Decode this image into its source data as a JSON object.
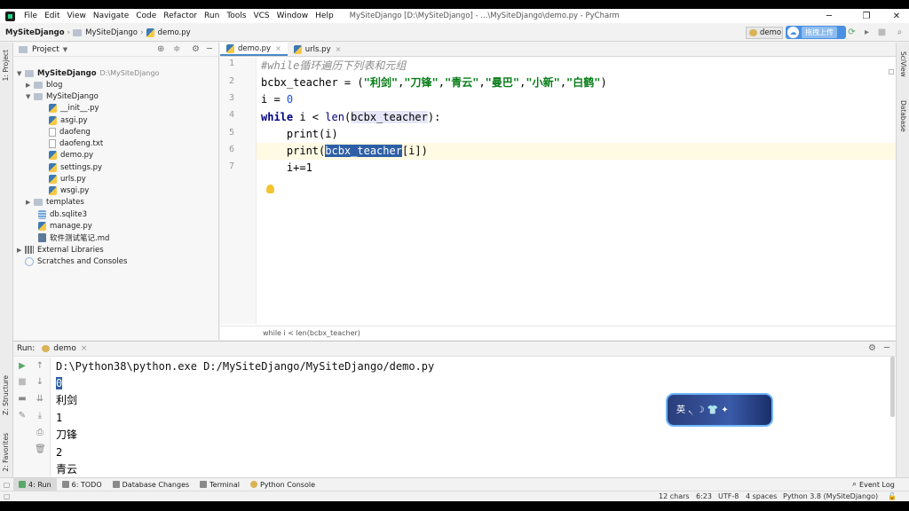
{
  "menubar": {
    "items": [
      "File",
      "Edit",
      "View",
      "Navigate",
      "Code",
      "Refactor",
      "Run",
      "Tools",
      "VCS",
      "Window",
      "Help"
    ],
    "window_title": "MySiteDjango [D:\\MySiteDjango] - ...\\MySiteDjango\\demo.py - PyCharm"
  },
  "navbar": {
    "crumbs": [
      "MySiteDjango",
      "MySiteDjango",
      "demo.py"
    ],
    "run_config": "demo",
    "cloud_label": "拖拽上传"
  },
  "project": {
    "title": "Project",
    "tree": [
      {
        "label": "MySiteDjango",
        "note": "D:\\MySiteDjango",
        "bold": true
      },
      {
        "label": "blog"
      },
      {
        "label": "MySiteDjango"
      },
      {
        "label": "__init__.py"
      },
      {
        "label": "asgi.py"
      },
      {
        "label": "daofeng"
      },
      {
        "label": "daofeng.txt"
      },
      {
        "label": "demo.py"
      },
      {
        "label": "settings.py"
      },
      {
        "label": "urls.py"
      },
      {
        "label": "wsgi.py"
      },
      {
        "label": "templates"
      },
      {
        "label": "db.sqlite3"
      },
      {
        "label": "manage.py"
      },
      {
        "label": "软件测试笔记.md"
      },
      {
        "label": "External Libraries"
      },
      {
        "label": "Scratches and Consoles"
      }
    ]
  },
  "editor": {
    "tabs": [
      "demo.py",
      "urls.py"
    ],
    "line_numbers": [
      "1",
      "2",
      "3",
      "4",
      "5",
      "6",
      "7"
    ],
    "line1_comment": "#while循环遍历下列表和元组",
    "line2_var": "bcbx_teacher",
    "line2_eq": " = (",
    "strings": [
      "\"利剑\"",
      "\"刀锋\"",
      "\"青云\"",
      "\"曼巴\"",
      "\"小新\"",
      "\"白鹤\""
    ],
    "line3": "i = ",
    "line3_num": "0",
    "line4_kw": "while",
    "line4_mid": " i < ",
    "line4_fn": "len",
    "line4_arg": "bcbx_teacher",
    "line4_end": "):",
    "line5": "    print(i)",
    "line6_pre": "    print(",
    "line6_sel": "bcbx_teacher",
    "line6_post": "[i])",
    "line7": "    i+=1",
    "breadcrumb": "while i < len(bcbx_teacher)"
  },
  "run": {
    "label": "Run:",
    "tab": "demo",
    "output": [
      "D:\\Python38\\python.exe D:/MySiteDjango/MySiteDjango/demo.py",
      "0",
      "利剑",
      "1",
      "刀锋",
      "2",
      "青云"
    ]
  },
  "ime": {
    "label": "英 ৲ ☽ 👕 ✦"
  },
  "side_labels": {
    "project": "1: Project",
    "structure": "Z: Structure",
    "favorites": "2: Favorites",
    "sciview": "SciView",
    "database": "Database"
  },
  "bottom_tools": [
    "4: Run",
    "6: TODO",
    "Database Changes",
    "Terminal",
    "Python Console",
    "Event Log"
  ],
  "status": {
    "chars": "12 chars",
    "pos": "6:23",
    "encoding": "UTF-8",
    "indent": "4 spaces",
    "interpreter": "Python 3.8 (MySiteDjango)"
  }
}
